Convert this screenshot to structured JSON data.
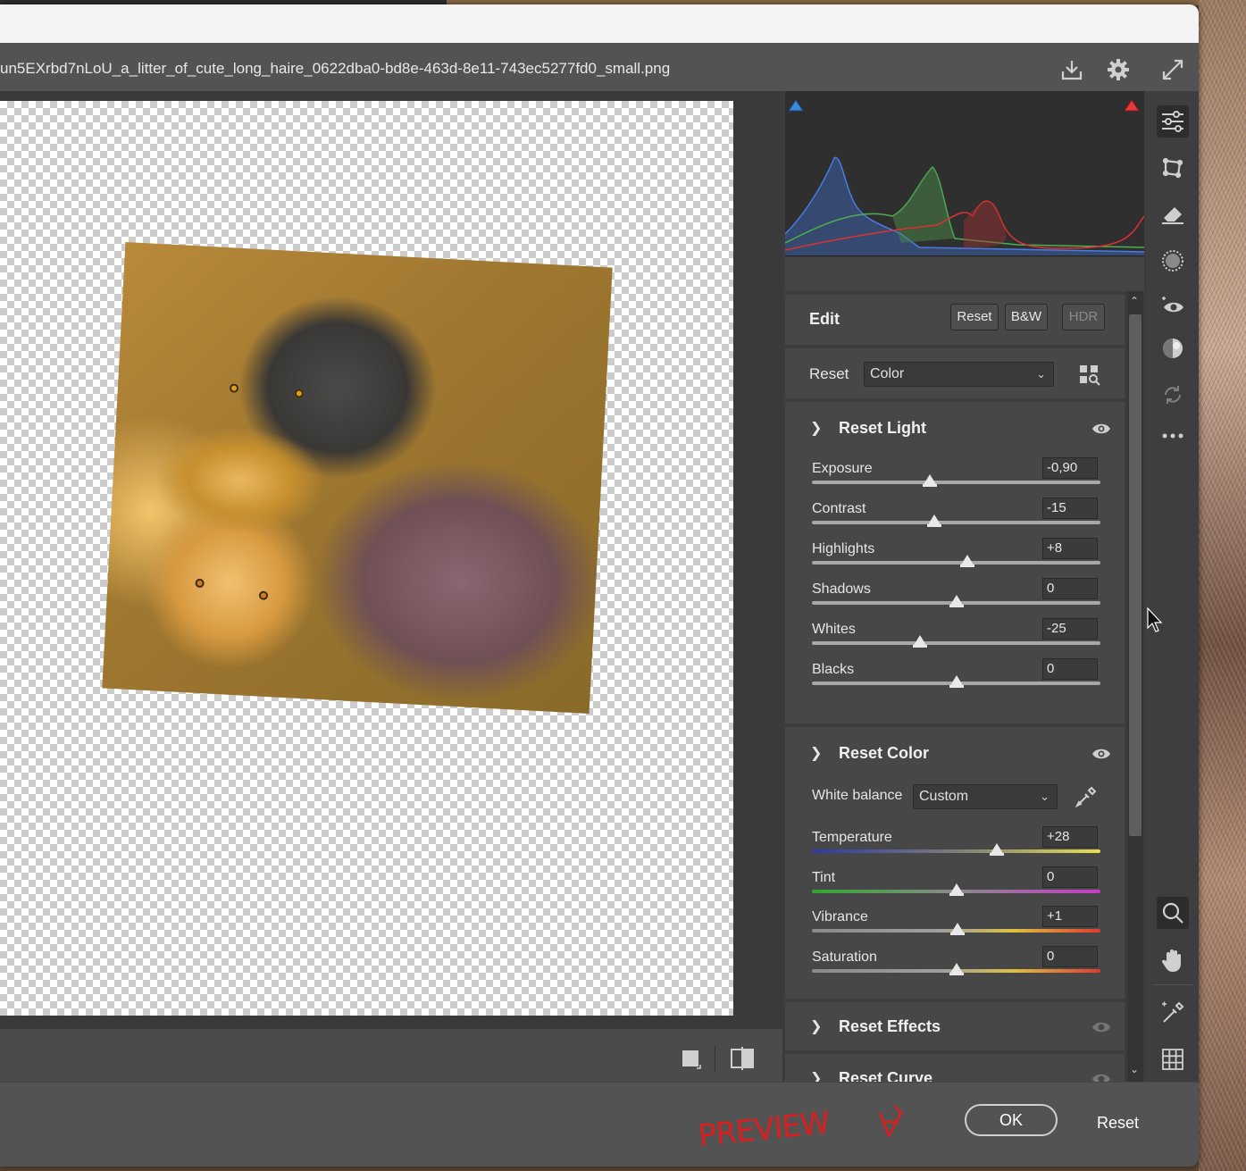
{
  "window": {
    "filename": "un5EXrbd7nLoU_a_litter_of_cute_long_haire_0622dba0-bd8e-463d-8e11-743ec5277fd0_small.png"
  },
  "icons": {
    "header": [
      "save-icon",
      "gear-icon",
      "fullscreen-icon"
    ],
    "toolbar": [
      "edit-sliders-icon",
      "crop-icon",
      "eraser-icon",
      "masking-icon",
      "redeye-icon",
      "presets-icon",
      "snapshot-icon",
      "more-icon",
      "zoom-icon",
      "hand-icon",
      "color-sampler-icon",
      "grid-icon"
    ],
    "canvas_bottom": [
      "single-view-icon",
      "before-after-icon"
    ]
  },
  "edit_panel": {
    "title": "Edit",
    "buttons": {
      "reset": "Reset",
      "bw": "B&W",
      "hdr": "HDR"
    },
    "profile_label": "Reset",
    "profile_value": "Color"
  },
  "light": {
    "title": "Reset Light",
    "sliders": [
      {
        "label": "Exposure",
        "value": "-0,90",
        "pos": 0.41
      },
      {
        "label": "Contrast",
        "value": "-15",
        "pos": 0.425
      },
      {
        "label": "Highlights",
        "value": "+8",
        "pos": 0.54
      },
      {
        "label": "Shadows",
        "value": "0",
        "pos": 0.5
      },
      {
        "label": "Whites",
        "value": "-25",
        "pos": 0.375
      },
      {
        "label": "Blacks",
        "value": "0",
        "pos": 0.5
      }
    ]
  },
  "color": {
    "title": "Reset Color",
    "white_balance_label": "White balance",
    "white_balance_value": "Custom",
    "sliders": [
      {
        "label": "Temperature",
        "value": "+28",
        "pos": 0.64
      },
      {
        "label": "Tint",
        "value": "0",
        "pos": 0.5
      },
      {
        "label": "Vibrance",
        "value": "+1",
        "pos": 0.505
      },
      {
        "label": "Saturation",
        "value": "0",
        "pos": 0.5
      }
    ]
  },
  "collapsed_sections": [
    "Reset Effects",
    "Reset Curve"
  ],
  "footer": {
    "ok": "OK",
    "reset": "Reset",
    "scribble": "PREVIEW"
  },
  "colors": {
    "panel_bg": "#474747",
    "dialog_bg": "#535353",
    "histogram_blue": "#3a6fd8",
    "histogram_green": "#4caf50",
    "histogram_red": "#e03030",
    "scribble_red": "#d82020"
  }
}
